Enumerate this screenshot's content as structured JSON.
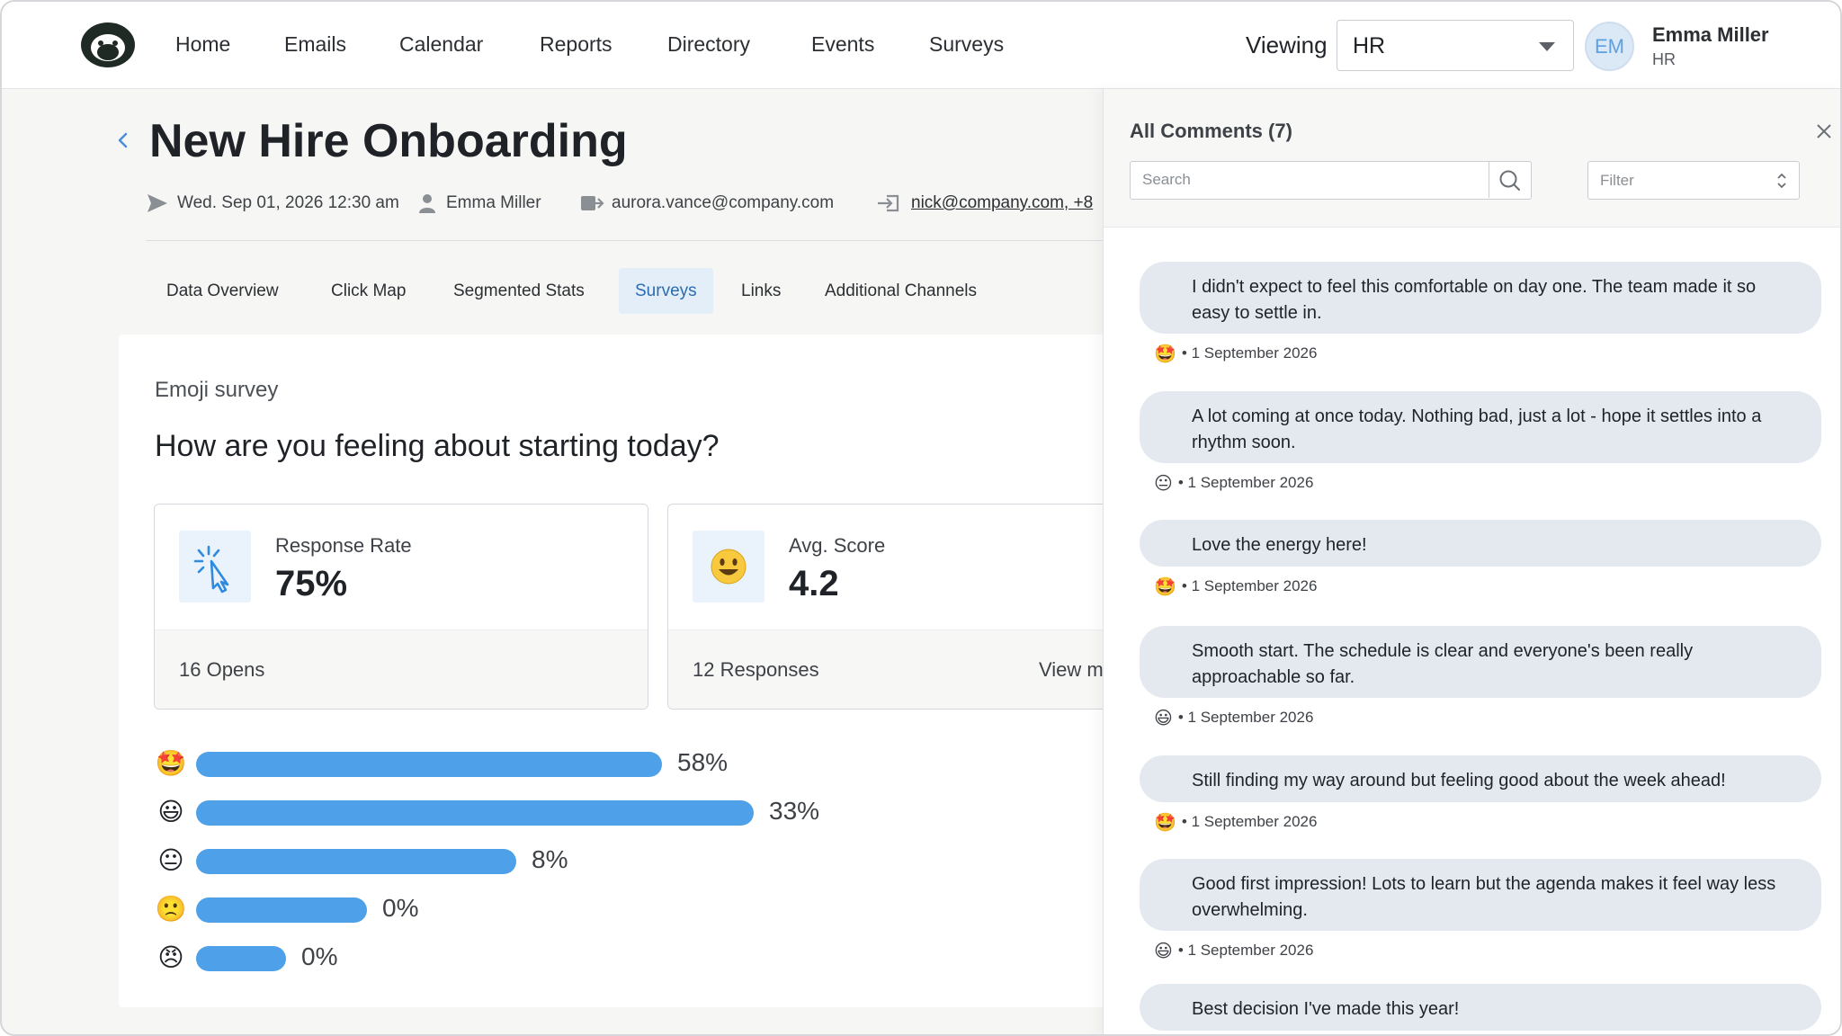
{
  "nav": {
    "items": [
      "Home",
      "Emails",
      "Calendar",
      "Reports",
      "Directory",
      "Events",
      "Surveys"
    ],
    "viewing_label": "Viewing",
    "viewing_value": "HR",
    "avatar_initials": "EM",
    "user_name": "Emma Miller",
    "user_dept": "HR"
  },
  "page": {
    "title": "New Hire Onboarding",
    "sent_date": "Wed. Sep 01, 2026 12:30 am",
    "author": "Emma Miller",
    "from_email": "aurora.vance@company.com",
    "to_emails": "nick@company.com, +8"
  },
  "tabs": [
    {
      "label": "Data Overview",
      "active": false
    },
    {
      "label": "Click Map",
      "active": false
    },
    {
      "label": "Segmented Stats",
      "active": false
    },
    {
      "label": "Surveys",
      "active": true
    },
    {
      "label": "Links",
      "active": false
    },
    {
      "label": "Additional Channels",
      "active": false
    }
  ],
  "survey": {
    "type": "Emoji survey",
    "question": "How are you feeling about starting today?",
    "response_rate_label": "Response Rate",
    "response_rate_value": "75%",
    "opens": "16 Opens",
    "avg_score_label": "Avg. Score",
    "avg_score_value": "4.2",
    "responses": "12 Responses",
    "view_more": "View m"
  },
  "chart_data": {
    "type": "bar",
    "categories": [
      "🤩",
      "😃",
      "😐",
      "🙁",
      "😠"
    ],
    "values": [
      58,
      33,
      8,
      0,
      0
    ],
    "value_labels": [
      "58%",
      "33%",
      "8%",
      "0%",
      "0%"
    ],
    "bar_color": "#4ea1e8"
  },
  "comments_panel": {
    "title": "All Comments (7)",
    "search_placeholder": "Search",
    "filter_placeholder": "Filter",
    "comments": [
      {
        "text": "I didn't expect to feel this comfortable on day one. The team made it so easy to settle in.",
        "emoji": "🤩",
        "date": "• 1 September 2026"
      },
      {
        "text": "A lot coming at once today. Nothing bad, just a lot - hope it settles into a rhythm soon.",
        "emoji": "😐",
        "date": "• 1 September 2026"
      },
      {
        "text": "Love the energy here!",
        "emoji": "🤩",
        "date": "• 1 September 2026"
      },
      {
        "text": "Smooth start. The schedule is clear and everyone's been really approachable so far.",
        "emoji": "😃",
        "date": "• 1 September 2026"
      },
      {
        "text": "Still finding my way around but feeling good about the week ahead!",
        "emoji": "🤩",
        "date": "• 1 September 2026"
      },
      {
        "text": "Good first impression! Lots to learn but the agenda makes it feel way less overwhelming.",
        "emoji": "😃",
        "date": "• 1 September 2026"
      },
      {
        "text": "Best decision I've made this year!",
        "emoji": "",
        "date": ""
      }
    ]
  },
  "colors": {
    "accent": "#4ea1e8",
    "active_tab_bg": "#e3eef8",
    "bubble_bg": "#e4e9f0"
  },
  "icons": {
    "logo": "monkey-logo-icon",
    "send": "send-icon",
    "person": "person-icon",
    "from": "outbox-icon",
    "to": "inbox-icon",
    "click": "cursor-click-icon",
    "avg": "smiley-icon",
    "search": "search-icon",
    "close": "close-icon"
  }
}
